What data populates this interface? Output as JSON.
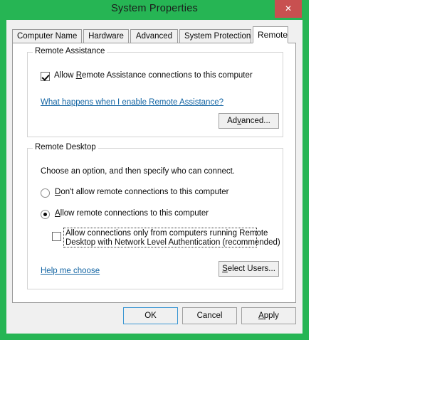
{
  "window": {
    "title": "System Properties",
    "close_label": "✕",
    "frame_color": "#26b554",
    "close_color": "#c85050"
  },
  "tabs": [
    {
      "label": "Computer Name",
      "selected": false
    },
    {
      "label": "Hardware",
      "selected": false
    },
    {
      "label": "Advanced",
      "selected": false
    },
    {
      "label": "System Protection",
      "selected": false
    },
    {
      "label": "Remote",
      "selected": true
    }
  ],
  "remote_assistance": {
    "group_title": "Remote Assistance",
    "allow_checkbox": {
      "label_pre": "Allow ",
      "label_accel": "R",
      "label_post": "emote Assistance connections to this computer",
      "checked": true
    },
    "help_link": "What happens when I enable Remote Assistance?",
    "advanced_button": {
      "pre": "Ad",
      "accel": "v",
      "post": "anced..."
    }
  },
  "remote_desktop": {
    "group_title": "Remote Desktop",
    "instruction": "Choose an option, and then specify who can connect.",
    "options": [
      {
        "id": "dont-allow",
        "label_pre": "",
        "label_accel": "D",
        "label_post": "on't allow remote connections to this computer",
        "selected": false
      },
      {
        "id": "allow",
        "label_pre": "",
        "label_accel": "A",
        "label_post": "llow remote connections to this computer",
        "selected": true
      }
    ],
    "nla_checkbox": {
      "line1": "Allow connections only from computers running Remote",
      "line2": "Desktop with Network Level Authentication (recommended)",
      "checked": false
    },
    "help_link": "Help me choose",
    "select_users_button": {
      "pre": "",
      "accel": "S",
      "post": "elect Users..."
    }
  },
  "footer": {
    "buttons": [
      {
        "id": "ok",
        "pre": "",
        "accel": "",
        "post": "OK",
        "default": true
      },
      {
        "id": "cancel",
        "pre": "",
        "accel": "",
        "post": "Cancel",
        "default": false
      },
      {
        "id": "apply",
        "pre": "",
        "accel": "A",
        "post": "pply",
        "default": false
      }
    ]
  }
}
